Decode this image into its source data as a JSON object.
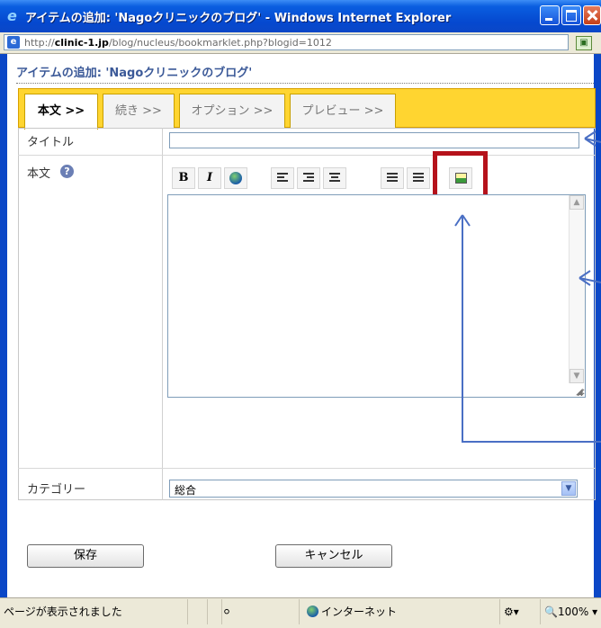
{
  "window": {
    "title": "アイテムの追加: 'Nagoクリニックのブログ' - Windows Internet Explorer"
  },
  "address": {
    "prefix": "http://",
    "domain": "clinic-1.jp",
    "path": "/blog/nucleus/bookmarklet.php?blogid=1012"
  },
  "page": {
    "heading": "アイテムの追加: 'Nagoクリニックのブログ'"
  },
  "tabs": [
    {
      "label": "本文 >>",
      "active": true
    },
    {
      "label": "続き >>",
      "active": false
    },
    {
      "label": "オプション >>",
      "active": false
    },
    {
      "label": "プレビュー >>",
      "active": false
    }
  ],
  "form": {
    "title_label": "タイトル",
    "title_value": "",
    "body_label": "本文",
    "help_glyph": "?",
    "body_value": "",
    "category_label": "カテゴリー",
    "category_value": "総合"
  },
  "toolbar": {
    "bold": "B",
    "italic": "I"
  },
  "buttons": {
    "save": "保存",
    "cancel": "キャンセル"
  },
  "statusbar": {
    "text": "ページが表示されました",
    "zone": "インターネット",
    "zoom": "100%"
  },
  "colors": {
    "annotation_arrow": "#4a6fc4",
    "highlight": "#b5121b",
    "tab_bar": "#ffd530"
  }
}
